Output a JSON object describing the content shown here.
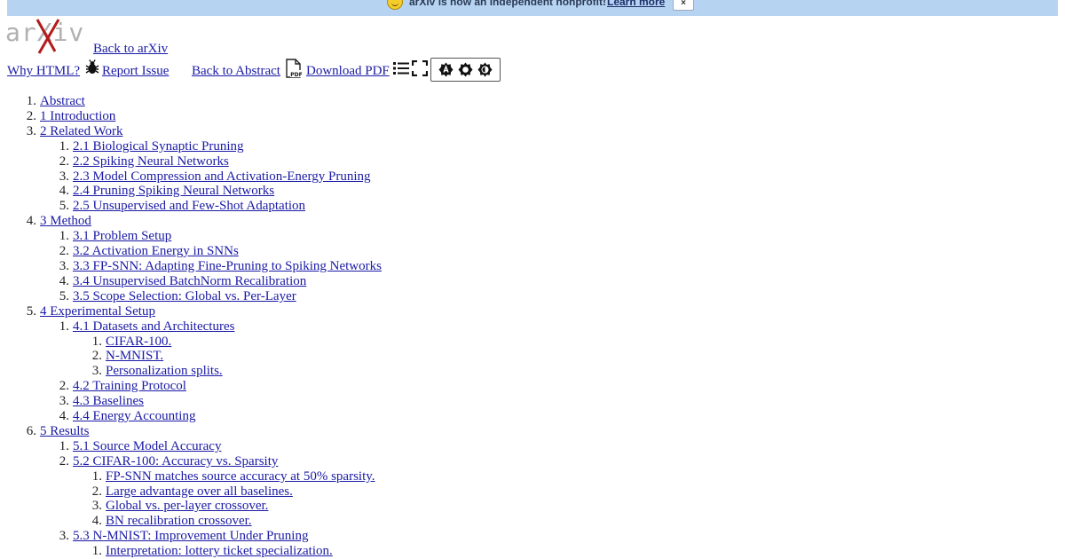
{
  "banner": {
    "message": "arXiv is now an independent nonprofit!",
    "learn_more": "Learn more",
    "close": "×"
  },
  "logo": {
    "text": "arXiv"
  },
  "header": {
    "back_to_arxiv": "Back to arXiv",
    "why_html": "Why HTML?",
    "report_issue": "Report Issue",
    "back_to_abstract": "Back to Abstract",
    "download_pdf": "Download PDF",
    "pdf_icon_label": "PDF"
  },
  "toc": [
    {
      "num": "1.",
      "label": "Abstract"
    },
    {
      "num": "2.",
      "label": "1 Introduction"
    },
    {
      "num": "3.",
      "label": "2 Related Work",
      "children": [
        {
          "num": "1.",
          "label": "2.1 Biological Synaptic Pruning"
        },
        {
          "num": "2.",
          "label": "2.2 Spiking Neural Networks"
        },
        {
          "num": "3.",
          "label": "2.3 Model Compression and Activation-Energy Pruning"
        },
        {
          "num": "4.",
          "label": "2.4 Pruning Spiking Neural Networks"
        },
        {
          "num": "5.",
          "label": "2.5 Unsupervised and Few-Shot Adaptation"
        }
      ]
    },
    {
      "num": "4.",
      "label": "3 Method",
      "children": [
        {
          "num": "1.",
          "label": "3.1 Problem Setup"
        },
        {
          "num": "2.",
          "label": "3.2 Activation Energy in SNNs"
        },
        {
          "num": "3.",
          "label": "3.3 FP-SNN: Adapting Fine-Pruning to Spiking Networks"
        },
        {
          "num": "4.",
          "label": "3.4 Unsupervised BatchNorm Recalibration"
        },
        {
          "num": "5.",
          "label": "3.5 Scope Selection: Global vs. Per-Layer"
        }
      ]
    },
    {
      "num": "5.",
      "label": "4 Experimental Setup",
      "children": [
        {
          "num": "1.",
          "label": "4.1 Datasets and Architectures",
          "children": [
            {
              "num": "1.",
              "label": "CIFAR-100."
            },
            {
              "num": "2.",
              "label": "N-MNIST."
            },
            {
              "num": "3.",
              "label": "Personalization splits."
            }
          ]
        },
        {
          "num": "2.",
          "label": "4.2 Training Protocol"
        },
        {
          "num": "3.",
          "label": "4.3 Baselines"
        },
        {
          "num": "4.",
          "label": "4.4 Energy Accounting"
        }
      ]
    },
    {
      "num": "6.",
      "label": "5 Results",
      "children": [
        {
          "num": "1.",
          "label": "5.1 Source Model Accuracy"
        },
        {
          "num": "2.",
          "label": "5.2 CIFAR-100: Accuracy vs. Sparsity",
          "children": [
            {
              "num": "1.",
              "label": "FP-SNN matches source accuracy at 50% sparsity."
            },
            {
              "num": "2.",
              "label": "Large advantage over all baselines."
            },
            {
              "num": "3.",
              "label": "Global vs. per-layer crossover."
            },
            {
              "num": "4.",
              "label": "BN recalibration crossover."
            }
          ]
        },
        {
          "num": "3.",
          "label": "5.3 N-MNIST: Improvement Under Pruning",
          "children": [
            {
              "num": "1.",
              "label": "Interpretation: lottery ticket specialization."
            }
          ]
        }
      ]
    }
  ],
  "icons": {
    "bug": "bug-icon",
    "pdf": "pdf-file-icon",
    "toc": "toc-list-icon",
    "expand": "fullscreen-icon",
    "theme": [
      "auto-theme-icon",
      "light-theme-icon",
      "dark-theme-icon"
    ]
  },
  "colors": {
    "link": "#1a1aa6",
    "banner_bg": "#b6d4f2",
    "logo_x": "#b31b1b",
    "logo_text": "#b1b1b1"
  }
}
